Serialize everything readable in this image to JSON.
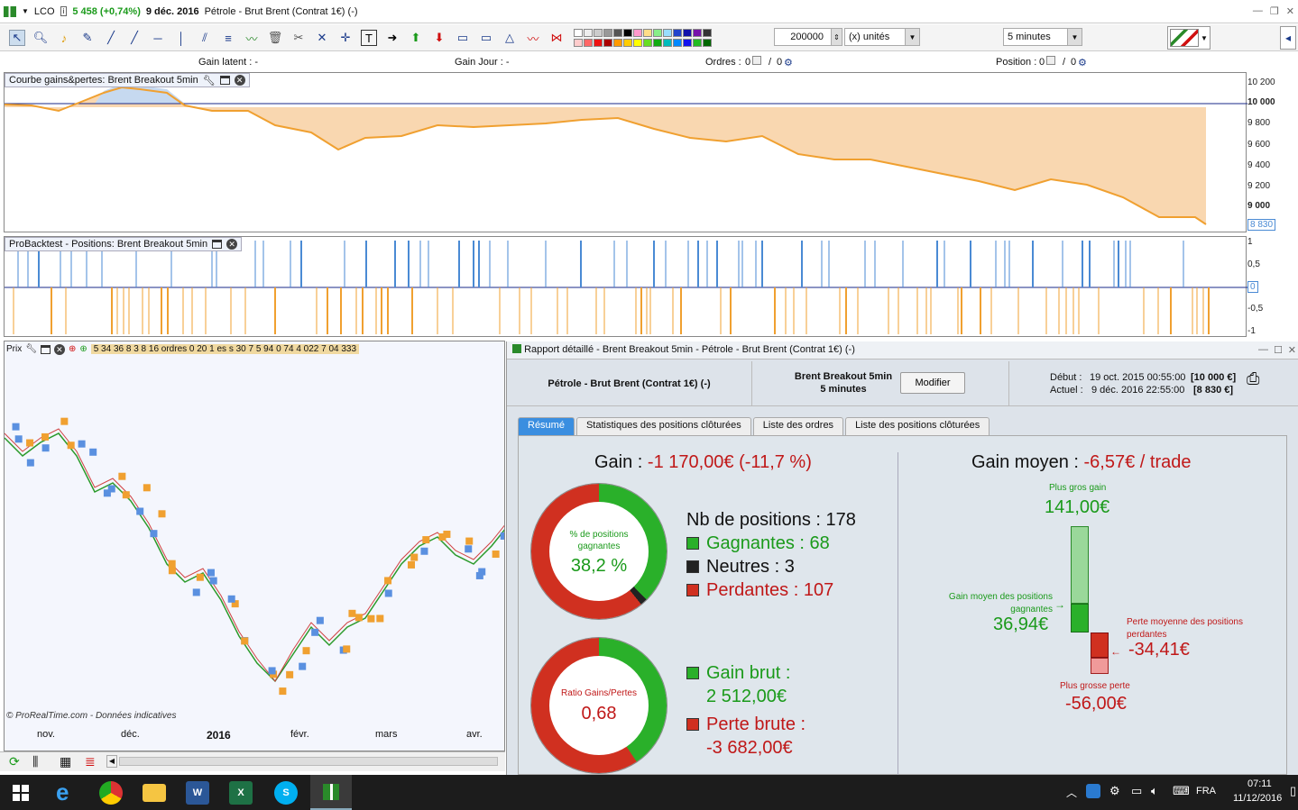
{
  "titlebar": {
    "symbol": "LCO",
    "price": "5 458 (+0,74%)",
    "date": "9 déc. 2016",
    "instrument": "Pétrole - Brut Brent (Contrat 1€) (-)"
  },
  "toolbar": {
    "quantity": "200000",
    "units": "(x) unités",
    "timeframe": "5 minutes"
  },
  "infobar": {
    "gain_latent": "Gain latent : -",
    "gain_jour": "Gain Jour : -",
    "ordres_label": "Ordres :",
    "ordres_a": "0",
    "ordres_sep": "/",
    "ordres_b": "0",
    "position_label": "Position :",
    "position_a": "0",
    "position_sep": "/",
    "position_b": "0"
  },
  "equity_panel": {
    "title": "Courbe gains&pertes: Brent Breakout 5min",
    "yticks": [
      "10 200",
      "10 000",
      "9 800",
      "9 600",
      "9 400",
      "9 200",
      "9 000"
    ],
    "last_value": "8 830"
  },
  "positions_panel": {
    "title": "ProBacktest - Positions: Brent Breakout 5min",
    "yticks": [
      "1",
      "0,5",
      "0",
      "-0,5",
      "-1"
    ]
  },
  "price_panel": {
    "title": "Prix",
    "header_strip": "5 34 36 8 3 8 16 ordres 0 20 1 es s 30 7 5 94 0 74 4 022 7 04 333",
    "footer_strip": "© ProRealTime.com - Données indicatives",
    "xlabels": [
      "nov.",
      "déc.",
      "2016",
      "févr.",
      "mars",
      "avr."
    ]
  },
  "report": {
    "title": "Rapport détaillé - Brent Breakout 5min - Pétrole - Brut Brent (Contrat 1€) (-)",
    "instrument": "Pétrole - Brut Brent (Contrat 1€) (-)",
    "system": "Brent Breakout 5min",
    "system_tf": "5 minutes",
    "modify_btn": "Modifier",
    "debut_label": "Début :",
    "debut_date": "19 oct. 2015 00:55:00",
    "debut_val": "[10 000 €]",
    "actuel_label": "Actuel :",
    "actuel_date": "9 déc. 2016 22:55:00",
    "actuel_val": "[8 830 €]",
    "tabs": [
      "Résumé",
      "Statistiques des positions clôturées",
      "Liste des ordres",
      "Liste des positions clôturées"
    ],
    "gain_label": "Gain :",
    "gain_value": "-1 170,00€ (-11,7 %)",
    "donut1_label": "% de positions gagnantes",
    "donut1_value": "38,2 %",
    "nb_positions": "Nb de positions : 178",
    "gagnantes": "Gagnantes : 68",
    "neutres": "Neutres : 3",
    "perdantes": "Perdantes : 107",
    "donut2_label": "Ratio Gains/Pertes",
    "donut2_value": "0,68",
    "gain_brut_label": "Gain brut :",
    "gain_brut_value": "2 512,00€",
    "perte_brute_label": "Perte brute :",
    "perte_brute_value": "-3 682,00€",
    "gain_moyen_label": "Gain moyen :",
    "gain_moyen_value": "-6,57€ / trade",
    "plus_gros_gain_label": "Plus gros gain",
    "plus_gros_gain_value": "141,00€",
    "gain_moyen_pos_label": "Gain moyen des positions gagnantes",
    "gain_moyen_pos_value": "36,94€",
    "perte_moyenne_label": "Perte moyenne des positions perdantes",
    "perte_moyenne_value": "-34,41€",
    "plus_grosse_perte_label": "Plus grosse perte",
    "plus_grosse_perte_value": "-56,00€"
  },
  "taskbar": {
    "lang": "FRA",
    "time": "07:11",
    "date": "11/12/2016"
  },
  "colors": {
    "equity_fill": "#f9d7b0",
    "equity_line": "#f0a030",
    "long_bar": "#4a8ad4",
    "short_bar": "#f0a030",
    "gain_green": "#1a9a1a",
    "loss_red": "#c01818"
  }
}
